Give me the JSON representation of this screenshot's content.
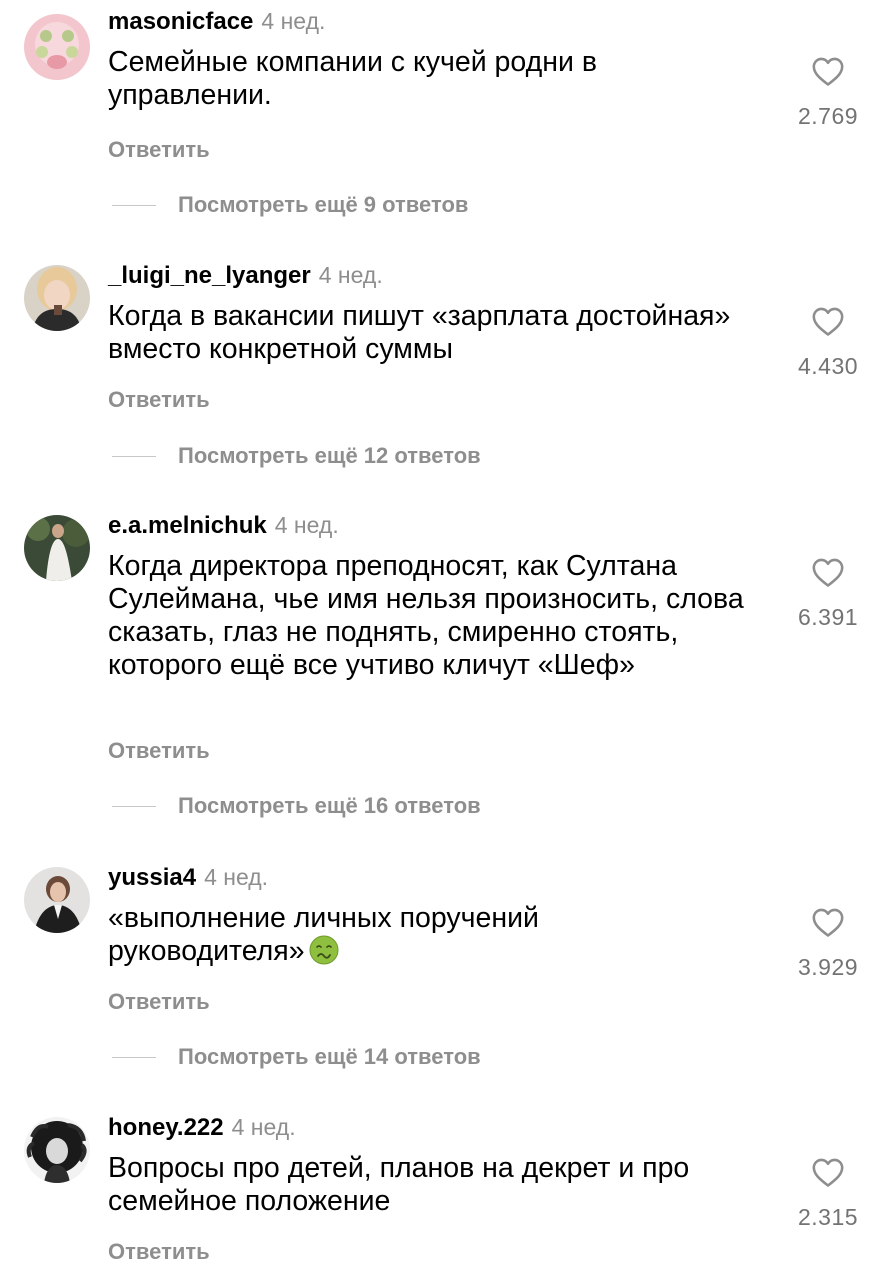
{
  "reply_label": "Ответить",
  "comments": [
    {
      "username": "masonicface",
      "time": "4 нед.",
      "text": "Семейные компании с кучей родни в управлении.",
      "likes": "2.769",
      "view_replies": "Посмотреть ещё 9 ответов"
    },
    {
      "username": "_luigi_ne_lyanger",
      "time": "4 нед.",
      "text": "Когда в вакансии пишут «зарплата достойная» вместо конкретной суммы",
      "likes": "4.430",
      "view_replies": "Посмотреть ещё 12 ответов"
    },
    {
      "username": "e.a.melnichuk",
      "time": "4 нед.",
      "text": "Когда директора преподносят, как Султана Сулеймана, чье имя нельзя произносить, слова сказать, глаз не поднять, смиренно стоять, которого ещё все учтиво кличут «Шеф»",
      "likes": "6.391",
      "view_replies": "Посмотреть ещё 16 ответов"
    },
    {
      "username": "yussia4",
      "time": "4 нед.",
      "text": "«выполнение личных поручений руководителя»",
      "emoji": "nauseated-face-emoji",
      "likes": "3.929",
      "view_replies": "Посмотреть ещё 14 ответов"
    },
    {
      "username": "honey.222",
      "time": "4 нед.",
      "text": "Вопросы про детей, планов на декрет и про семейное положение",
      "likes": "2.315"
    }
  ],
  "icons": {
    "like": "heart-outline-icon",
    "emoji": "nauseated-face-emoji"
  },
  "colors": {
    "text": "#000000",
    "secondary": "#8e8e8e",
    "count": "#737373"
  }
}
